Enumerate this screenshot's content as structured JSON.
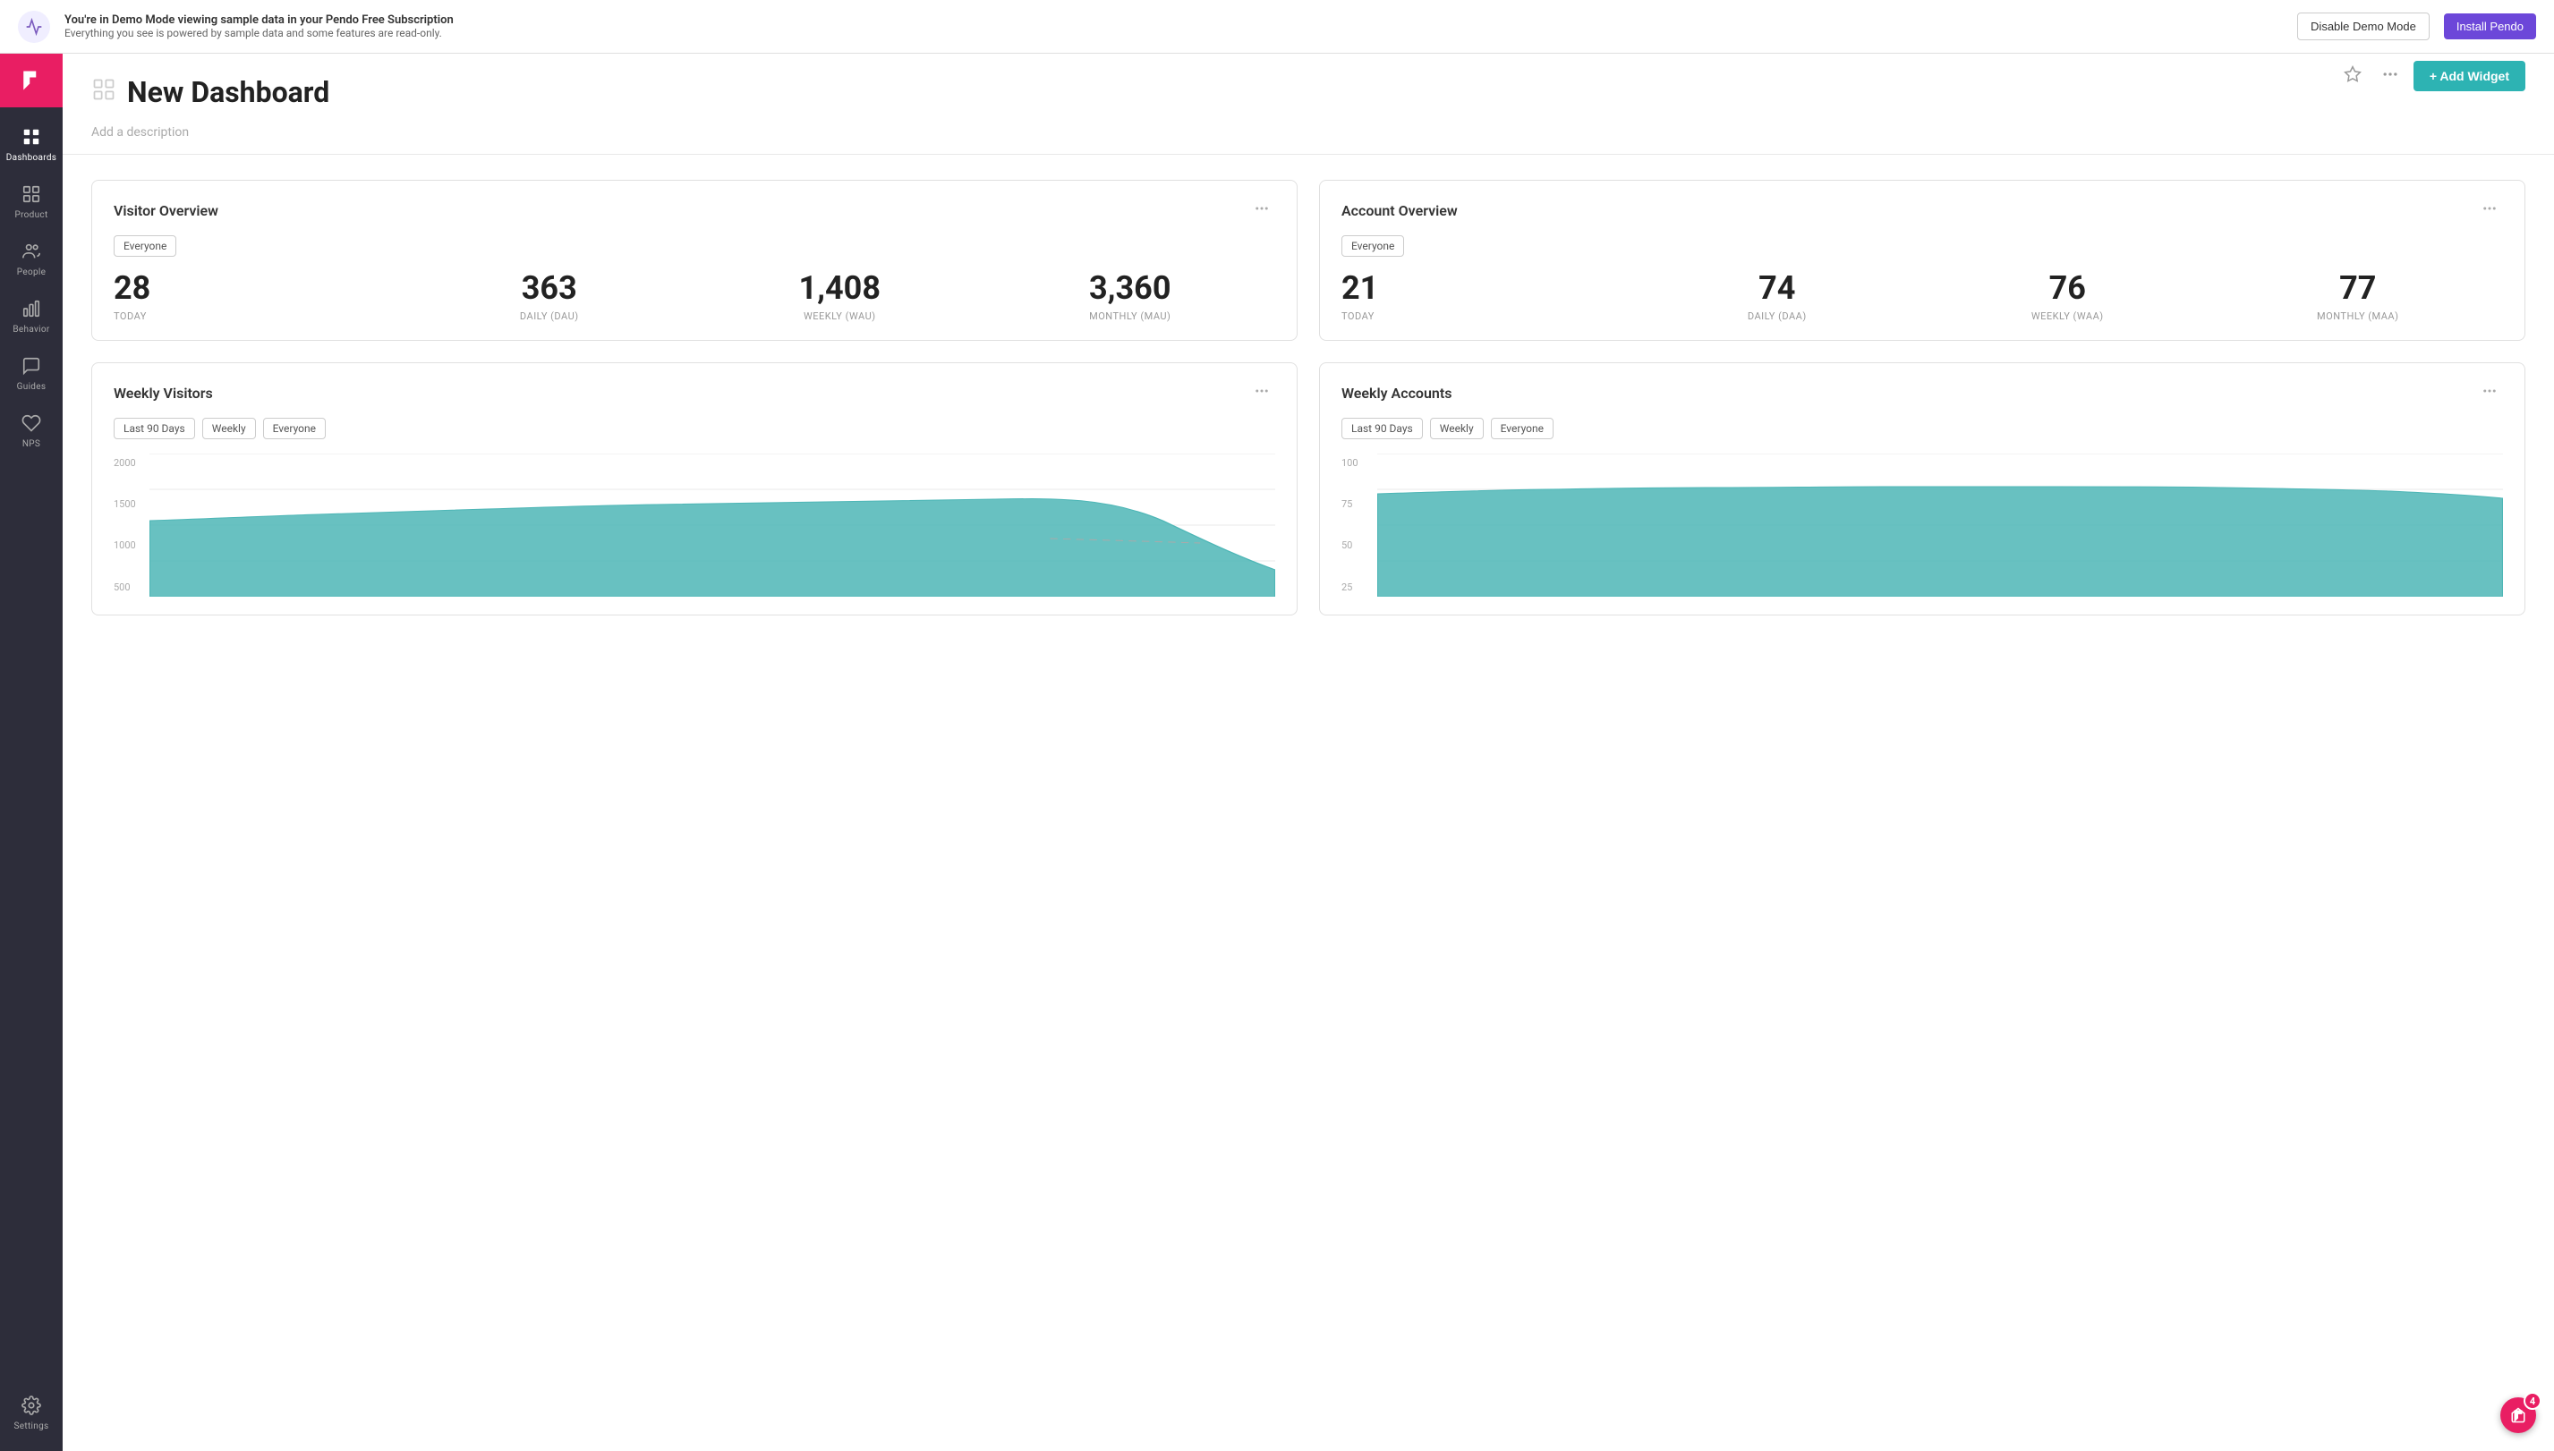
{
  "demo_banner": {
    "main_text": "You're in Demo Mode viewing sample data in your Pendo Free Subscription",
    "sub_text": "Everything you see is powered by sample data and some features are read-only.",
    "disable_btn": "Disable Demo Mode",
    "install_btn": "Install Pendo"
  },
  "sidebar": {
    "logo_label": "Pendo",
    "items": [
      {
        "id": "dashboards",
        "label": "Dashboards",
        "icon": "⊞",
        "active": true
      },
      {
        "id": "product",
        "label": "Product",
        "icon": "▦"
      },
      {
        "id": "people",
        "label": "People",
        "icon": "👥"
      },
      {
        "id": "behavior",
        "label": "Behavior",
        "icon": "📊"
      },
      {
        "id": "guides",
        "label": "Guides",
        "icon": "💬"
      },
      {
        "id": "nps",
        "label": "NPS",
        "icon": "♡"
      }
    ],
    "bottom_items": [
      {
        "id": "settings",
        "label": "Settings",
        "icon": "⚙"
      }
    ]
  },
  "page": {
    "title": "New Dashboard",
    "description": "Add a description",
    "add_widget_btn": "+ Add Widget"
  },
  "widgets": {
    "visitor_overview": {
      "title": "Visitor Overview",
      "tag": "Everyone",
      "stats": [
        {
          "value": "28",
          "label": "TODAY"
        },
        {
          "value": "363",
          "label": "DAILY (DAU)"
        },
        {
          "value": "1,408",
          "label": "WEEKLY (WAU)"
        },
        {
          "value": "3,360",
          "label": "MONTHLY (MAU)"
        }
      ]
    },
    "account_overview": {
      "title": "Account Overview",
      "tag": "Everyone",
      "stats": [
        {
          "value": "21",
          "label": "TODAY"
        },
        {
          "value": "74",
          "label": "DAILY (DAA)"
        },
        {
          "value": "76",
          "label": "WEEKLY (WAA)"
        },
        {
          "value": "77",
          "label": "MONTHLY (MAA)"
        }
      ]
    },
    "weekly_visitors": {
      "title": "Weekly Visitors",
      "tags": [
        "Last 90 Days",
        "Weekly",
        "Everyone"
      ],
      "chart_y_labels": [
        "2000",
        "1500",
        "1000",
        "500"
      ],
      "chart_color": "#4db6b6"
    },
    "weekly_accounts": {
      "title": "Weekly Accounts",
      "tags": [
        "Last 90 Days",
        "Weekly",
        "Everyone"
      ],
      "chart_y_labels": [
        "100",
        "75",
        "50",
        "25"
      ],
      "chart_color": "#4db6b6"
    }
  },
  "notification": {
    "count": "4"
  }
}
